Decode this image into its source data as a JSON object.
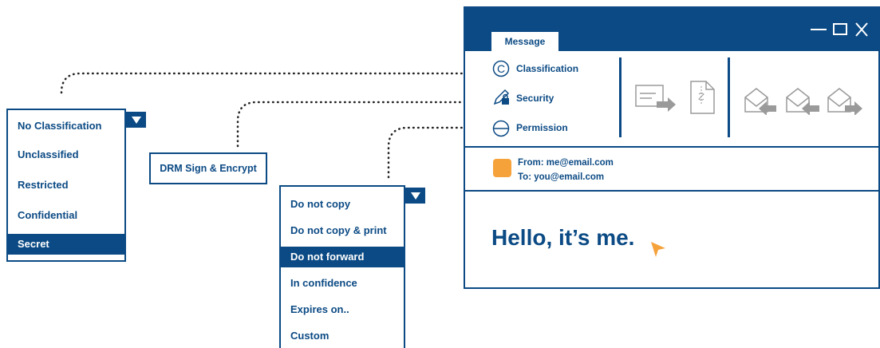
{
  "classification_dropdown": {
    "items": [
      "No Classification",
      "Unclassified",
      "Restricted",
      "Confidential",
      "Secret"
    ],
    "selected_index": 4
  },
  "drm": {
    "label": "DRM Sign & Encrypt"
  },
  "permission_dropdown": {
    "items": [
      "Do not copy",
      "Do not copy & print",
      "Do not forward",
      "In confidence",
      "Expires on..",
      "Custom"
    ],
    "selected_index": 2
  },
  "window": {
    "tab_label": "Message",
    "ribbon": {
      "classification_label": "Classification",
      "security_label": "Security",
      "permission_label": "Permission"
    },
    "header": {
      "from": "From: me@email.com",
      "to": "To: you@email.com"
    },
    "body_text": "Hello, it’s me.",
    "colors": {
      "primary": "#0b4a84",
      "accent": "#f5a23a",
      "icon_gray": "#9a9a9a"
    }
  }
}
